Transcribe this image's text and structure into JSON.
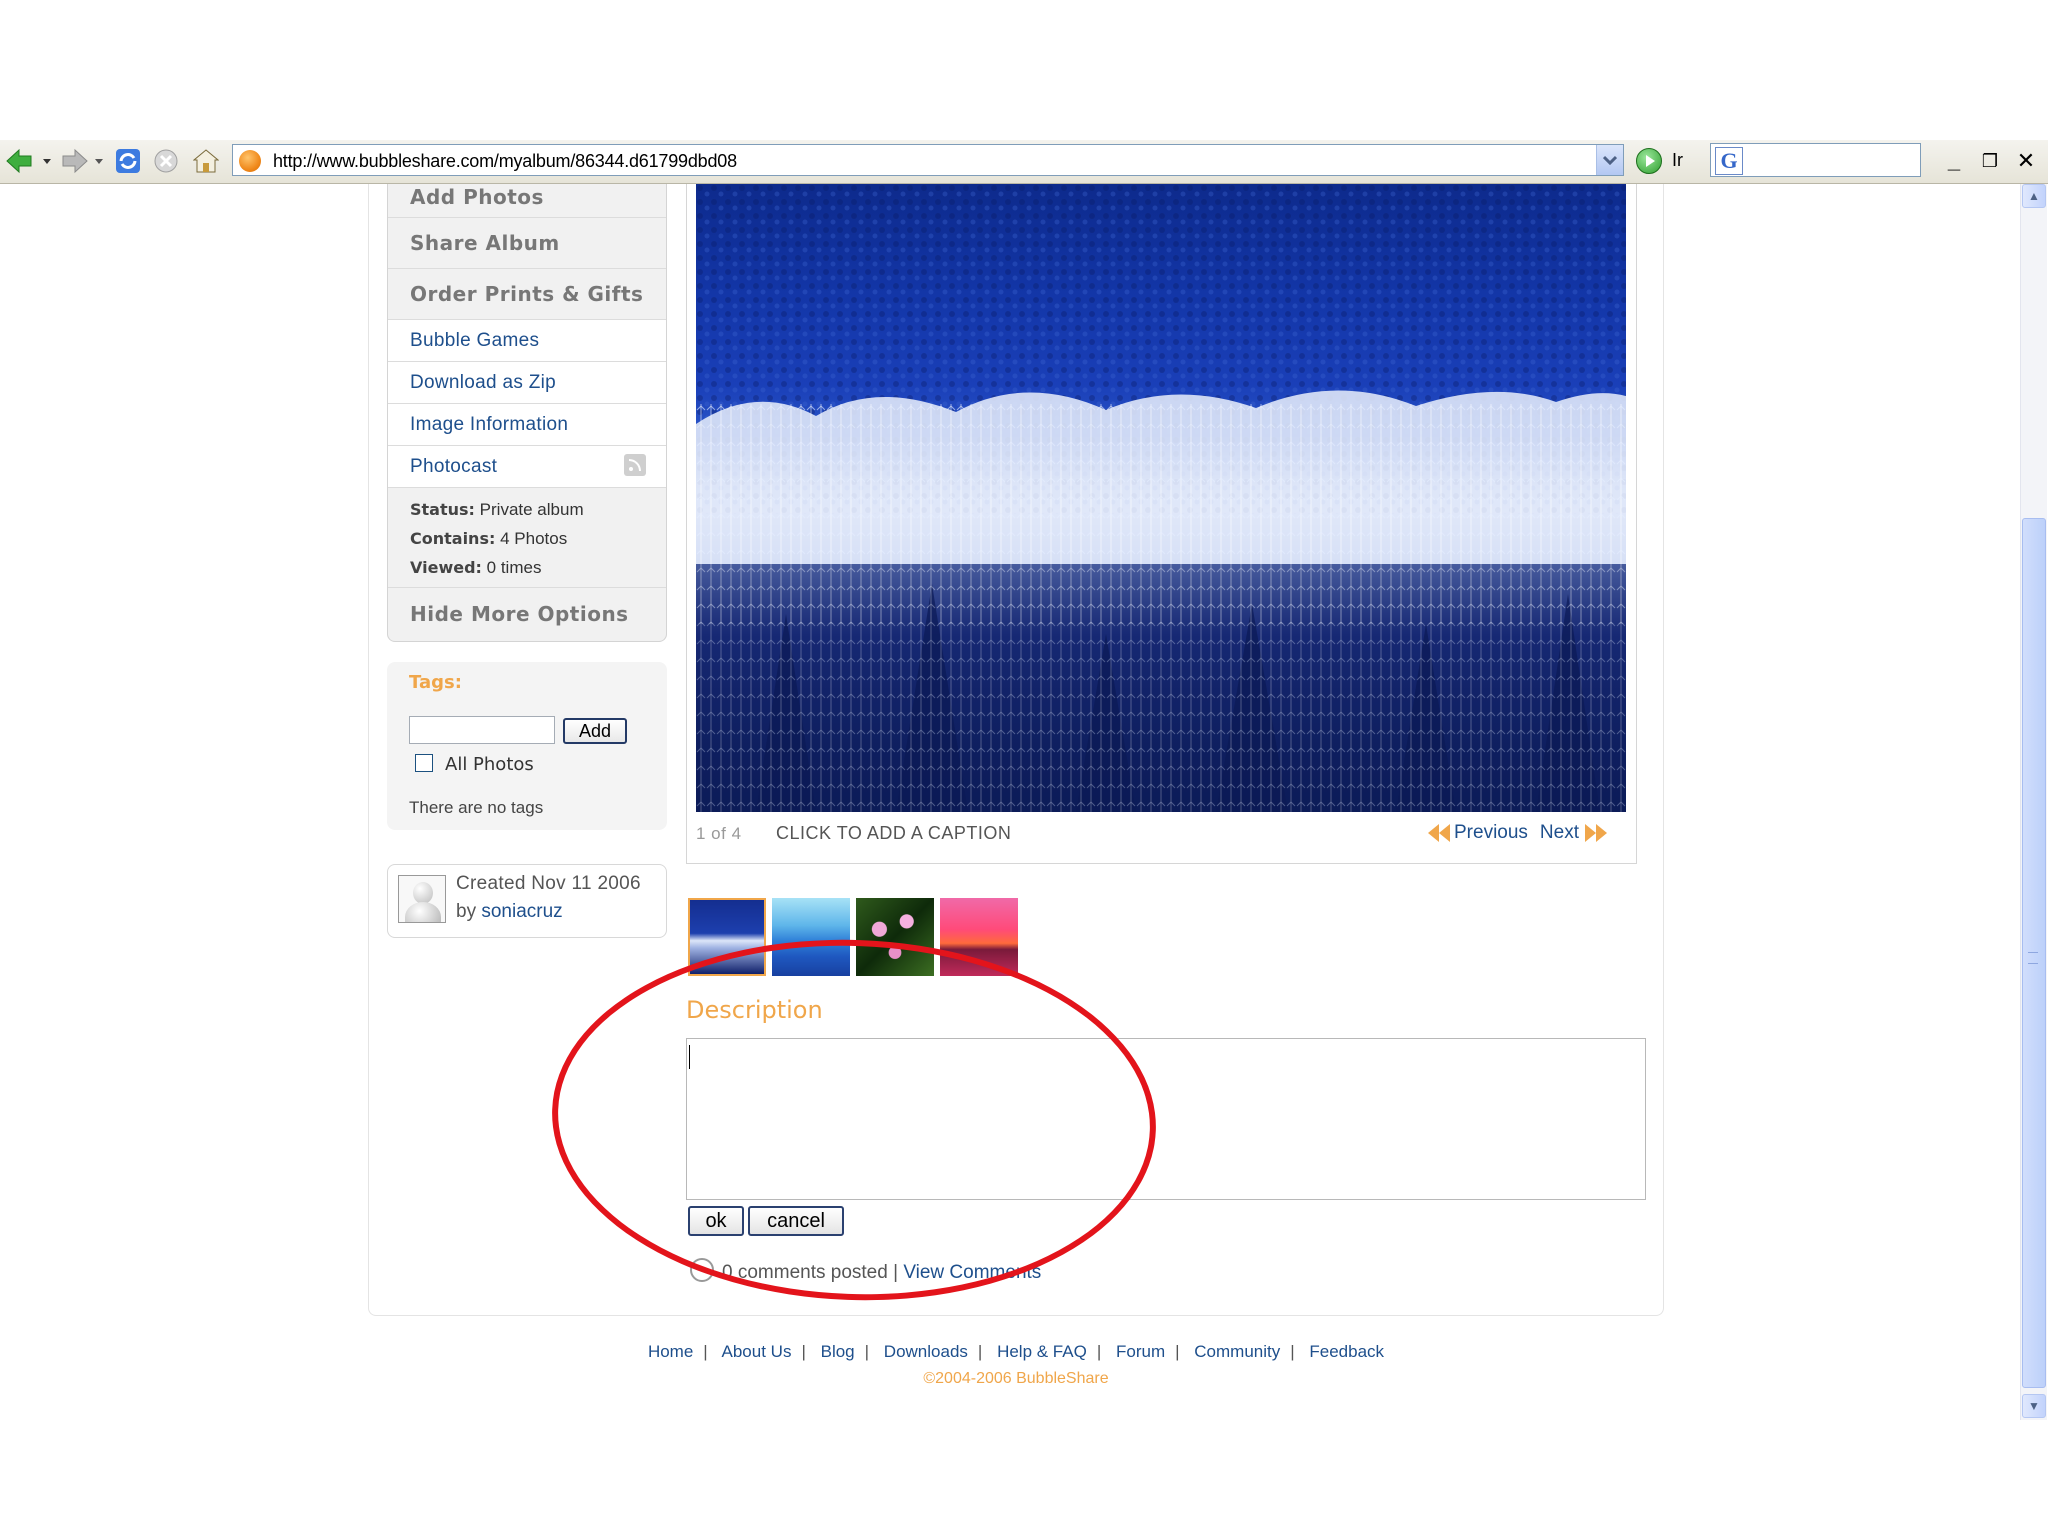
{
  "browser": {
    "url": "http://www.bubbleshare.com/myalbum/86344.d61799dbd08",
    "go_label": "Ir"
  },
  "sidebar": {
    "menu_items": [
      {
        "label": "Add Photos",
        "style": "bold"
      },
      {
        "label": "Share Album",
        "style": "bold"
      },
      {
        "label": "Order Prints & Gifts",
        "style": "bold"
      },
      {
        "label": "Bubble Games",
        "style": "link"
      },
      {
        "label": "Download as Zip",
        "style": "link"
      },
      {
        "label": "Image Information",
        "style": "link"
      },
      {
        "label": "Photocast",
        "style": "link",
        "icon": "rss-icon"
      }
    ],
    "status": {
      "status_label": "Status:",
      "status_value": "Private album",
      "contains_label": "Contains:",
      "contains_value": "4 Photos",
      "viewed_label": "Viewed:",
      "viewed_value": "0 times"
    },
    "hide_options_label": "Hide More Options",
    "tags": {
      "label": "Tags:",
      "input_value": "",
      "add_button": "Add",
      "checkbox_label": "All Photos",
      "checkbox_checked": false,
      "empty_text": "There are no tags"
    },
    "creator": {
      "created": "Created Nov 11 2006",
      "by_prefix": "by",
      "username": "soniacruz"
    }
  },
  "photo": {
    "counter": "1 of 4",
    "caption_prompt": "CLICK TO ADD A CAPTION",
    "previous_label": "Previous",
    "next_label": "Next",
    "thumbnails": [
      "winter-forest",
      "blue-mountains",
      "water-lilies",
      "pink-sunset"
    ],
    "selected_thumbnail": 0
  },
  "description": {
    "title": "Description",
    "value": "",
    "ok_label": "ok",
    "cancel_label": "cancel",
    "comments_text": "0 comments posted",
    "comments_separator": "|",
    "view_comments_label": "View Comments"
  },
  "footer": {
    "links": [
      "Home",
      "About Us",
      "Blog",
      "Downloads",
      "Help & FAQ",
      "Forum",
      "Community",
      "Feedback"
    ],
    "copyright": "©2004-2006 BubbleShare"
  },
  "colors": {
    "accent_orange": "#f0a64a",
    "link_blue": "#1e4f8c",
    "annotation_red": "#e3141b"
  }
}
